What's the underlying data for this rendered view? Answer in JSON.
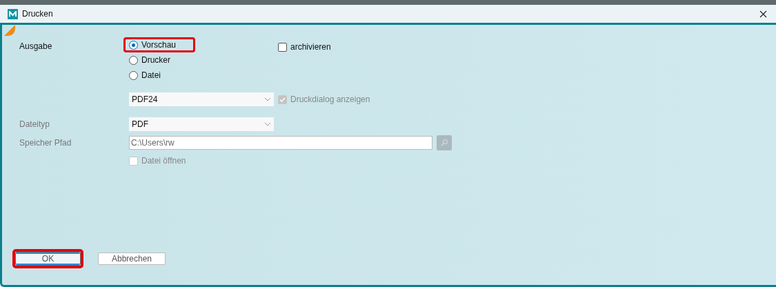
{
  "window": {
    "title": "Drucken"
  },
  "output": {
    "label": "Ausgabe",
    "options": [
      {
        "label": "Vorschau",
        "selected": true,
        "highlighted": true
      },
      {
        "label": "Drucker",
        "selected": false,
        "highlighted": false
      },
      {
        "label": "Datei",
        "selected": false,
        "highlighted": false
      }
    ],
    "archive": {
      "label": "archivieren",
      "checked": false
    }
  },
  "printer": {
    "value": "PDF24",
    "show_dialog": {
      "label": "Druckdialog anzeigen",
      "checked": true,
      "disabled": true
    }
  },
  "file_type": {
    "label": "Dateityp",
    "value": "PDF"
  },
  "save_path": {
    "label": "Speicher Pfad",
    "value": "C:\\Users\\rw"
  },
  "open_file": {
    "label": "Datei öffnen",
    "checked": false,
    "disabled": true
  },
  "buttons": [
    {
      "label": "OK",
      "highlighted": true,
      "focused": true
    },
    {
      "label": "Abbrechen",
      "highlighted": false,
      "focused": false
    }
  ]
}
